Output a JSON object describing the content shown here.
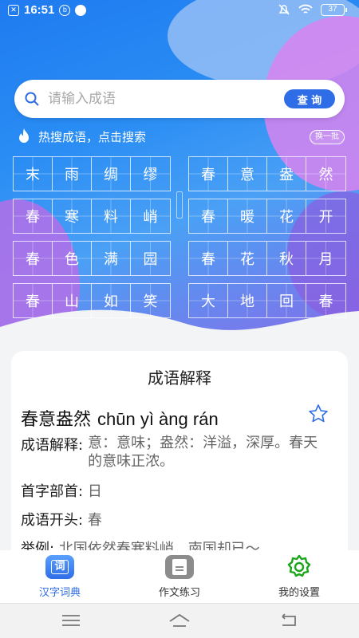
{
  "status": {
    "time": "16:51",
    "battery": "37"
  },
  "search": {
    "placeholder": "请输入成语",
    "button": "查 询"
  },
  "hot": {
    "label": "热搜成语，点击搜索",
    "swap": "换一批"
  },
  "idioms": [
    [
      "末",
      "雨",
      "绸",
      "缪"
    ],
    [
      "春",
      "意",
      "盎",
      "然"
    ],
    [
      "春",
      "寒",
      "料",
      "峭"
    ],
    [
      "春",
      "暖",
      "花",
      "开"
    ],
    [
      "春",
      "色",
      "满",
      "园"
    ],
    [
      "春",
      "花",
      "秋",
      "月"
    ],
    [
      "春",
      "山",
      "如",
      "笑"
    ],
    [
      "大",
      "地",
      "回",
      "春"
    ]
  ],
  "card": {
    "title": "成语解释",
    "idiom": "春意盎然",
    "pinyin": "chūn yì àng rán",
    "explain_key": "成语解释:",
    "explain_val": "意：意味；盎然：洋溢，深厚。春天的意味正浓。",
    "radical_key": "首字部首:",
    "radical_val": "日",
    "start_key": "成语开头:",
    "start_val": "春",
    "example_key": "举例:",
    "example_val": "北国依然春寒料峭，南国却已～"
  },
  "tabs": [
    {
      "label": "汉字词典",
      "icon": "dictionary-icon",
      "glyph": "词"
    },
    {
      "label": "作文练习",
      "icon": "composition-icon"
    },
    {
      "label": "我的设置",
      "icon": "gear-icon"
    }
  ],
  "colors": {
    "accent": "#2f6de6",
    "gear": "#1aa51a"
  }
}
